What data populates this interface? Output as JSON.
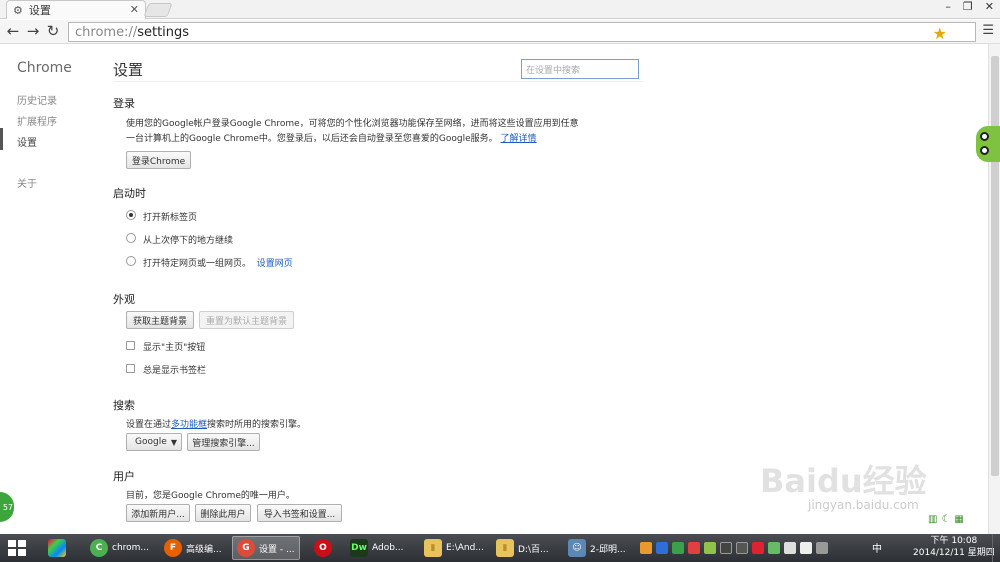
{
  "browser": {
    "tab_title": "设置",
    "tab_close": "✕",
    "url_scheme": "chrome://",
    "url_path": "settings",
    "window_controls": [
      "–",
      "❐",
      "✕"
    ]
  },
  "sidebar": {
    "brand": "Chrome",
    "items": [
      {
        "label": "历史记录"
      },
      {
        "label": "扩展程序"
      },
      {
        "label": "设置"
      },
      {
        "label": "关于"
      }
    ]
  },
  "main": {
    "title": "设置",
    "search_placeholder": "在设置中搜索",
    "signin": {
      "heading": "登录",
      "line1": "使用您的Google帐户登录Google Chrome，可将您的个性化浏览器功能保存至网络，进而将这些设置应用到任意",
      "line2": "一台计算机上的Google Chrome中。您登录后，以后还会自动登录至您喜爱的Google服务。",
      "learn_more": "了解详情",
      "button": "登录Chrome"
    },
    "startup": {
      "heading": "启动时",
      "options": [
        {
          "label": "打开新标签页",
          "selected": true
        },
        {
          "label": "从上次停下的地方继续",
          "selected": false
        },
        {
          "label": "打开特定网页或一组网页。",
          "selected": false
        }
      ],
      "set_pages_link": "设置网页"
    },
    "appearance": {
      "heading": "外观",
      "get_themes": "获取主题背景",
      "reset_theme": "重置为默认主题背景",
      "show_home": "显示\"主页\"按钮",
      "show_bookmarks": "总是显示书签栏"
    },
    "search": {
      "heading": "搜索",
      "desc_before": "设置在通过",
      "desc_link": "多功能框",
      "desc_after": "搜索时所用的搜索引擎。",
      "engine": "Google",
      "manage": "管理搜索引擎..."
    },
    "users": {
      "heading": "用户",
      "desc": "目前，您是Google Chrome的唯一用户。",
      "add": "添加新用户...",
      "delete": "删除此用户",
      "import": "导入书签和设置..."
    }
  },
  "overlay": {
    "bubble": "57",
    "watermark": "Baidu经验",
    "watermark_url": "jingyan.baidu.com"
  },
  "taskbar": {
    "items": [
      {
        "label": "chrom...",
        "color": "#4caf50",
        "icon": "C"
      },
      {
        "label": "高级编...",
        "color": "#e66000",
        "icon": "F"
      },
      {
        "label": "设置 - ...",
        "color": "#dd4b39",
        "icon": "G"
      },
      {
        "label": "",
        "color": "#cc0f16",
        "icon": "O"
      },
      {
        "label": "Adob...",
        "color": "#1a3a1a",
        "icon": "Dw"
      },
      {
        "label": "E:\\And...",
        "color": "#e8c25a",
        "icon": "▮"
      },
      {
        "label": "D:\\百...",
        "color": "#e8c25a",
        "icon": "▮"
      },
      {
        "label": "2-邱明...",
        "color": "#5d87b5",
        "icon": "☺"
      }
    ],
    "ime": "中",
    "time": "10:08",
    "ampm": "下午",
    "date": "2014/12/11 星期四"
  }
}
